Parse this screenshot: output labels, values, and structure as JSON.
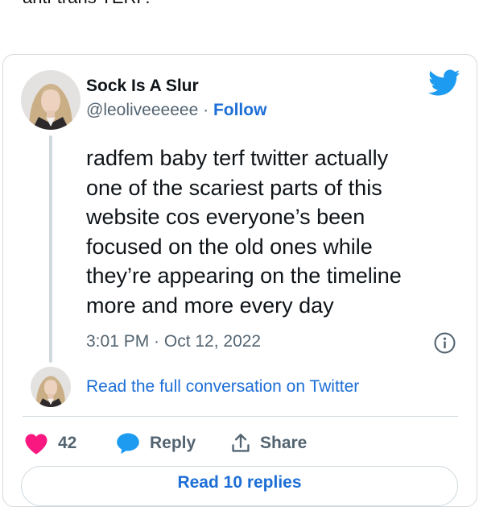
{
  "top_text": "anti-trans TERF.",
  "tweet": {
    "display_name": "Sock Is A Slur",
    "handle": "@leoliveeeeee",
    "separator": "·",
    "follow_label": "Follow",
    "text_lines": [
      "radfem baby terf twitter actually",
      "one of the scariest parts of this",
      "website cos everyone’s been",
      "focused on the old ones while",
      "they’re appearing on the timeline",
      "more and more every day"
    ],
    "timestamp": "3:01 PM · Oct 12, 2022",
    "read_full_label": "Read the full conversation on Twitter",
    "actions": {
      "like_count": "42",
      "reply_label": "Reply",
      "share_label": "Share"
    },
    "read_replies_label": "Read 10 replies"
  },
  "colors": {
    "link_blue": "#1d6fd6",
    "twitter_blue": "#1d9bf0",
    "like_pink": "#f91880",
    "muted_text": "#536471",
    "border": "#cfd9de"
  },
  "icons": [
    "twitter-bird-icon",
    "info-icon",
    "heart-icon",
    "reply-bubble-icon",
    "share-icon"
  ]
}
